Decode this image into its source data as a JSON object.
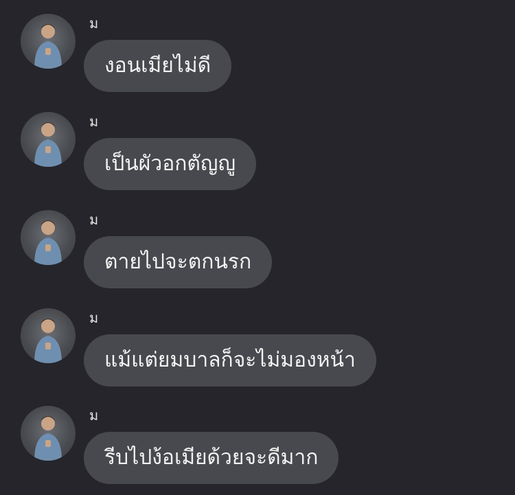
{
  "messages": [
    {
      "sender": "ม",
      "text": "งอนเมียไม่ดี",
      "avatar_icon": "profile-photo-icon"
    },
    {
      "sender": "ม",
      "text": "เป็นผัวอกตัญญู",
      "avatar_icon": "profile-photo-icon"
    },
    {
      "sender": "ม",
      "text": "ตายไปจะตกนรก",
      "avatar_icon": "profile-photo-icon"
    },
    {
      "sender": "ม",
      "text": "แม้แต่ยมบาลก็จะไม่มองหน้า",
      "avatar_icon": "profile-photo-icon"
    },
    {
      "sender": "ม",
      "text": "รีบไปง้อเมียด้วยจะดีมาก",
      "avatar_icon": "profile-photo-icon"
    }
  ],
  "colors": {
    "background": "#25252b",
    "bubble": "#48494e",
    "text": "#f2f2f2"
  }
}
